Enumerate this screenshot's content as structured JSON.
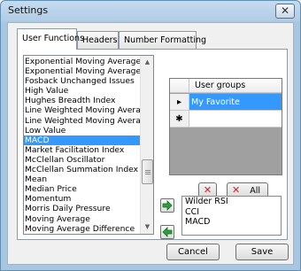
{
  "window": {
    "title": "Settings",
    "close_glyph": "✕"
  },
  "tabs": [
    {
      "label": "User Functions"
    },
    {
      "label": "Headers"
    },
    {
      "label": "Number Formatting"
    }
  ],
  "functions": {
    "items": [
      "Exponential Moving Average (",
      "Exponential Moving Average (",
      "Fosback Unchanged Issues",
      "High Value",
      "Hughes Breadth Index",
      "Line Weighted Moving Averag",
      "Line Weighted Moving Averag",
      "Low Value",
      "MACD",
      "Market Facilitation Index",
      "McClellan Oscillator",
      "McClellan Summation Index",
      "Mean",
      "Median Price",
      "Momentum",
      "Morris Daily Pressure",
      "Moving Average",
      "Moving Average Difference"
    ],
    "selected_index": 8
  },
  "user_groups": {
    "column_header": "User groups",
    "rows": [
      {
        "indicator": "▸",
        "value": "My Favorite"
      },
      {
        "indicator": "✱",
        "value": ""
      }
    ]
  },
  "group_buttons": {
    "delete_icon": "✕",
    "delete_all_label": "All"
  },
  "group_functions": {
    "items": [
      "Wilder RSI",
      "CCI",
      "MACD"
    ]
  },
  "actions": {
    "cancel_label": "Cancel",
    "save_label": "Save"
  },
  "colors": {
    "selection": "#3399ff",
    "add_arrow": "#2e9e3a",
    "delete": "#d42020"
  },
  "icons": {
    "add": "arrow-right-icon",
    "remove": "arrow-left-icon"
  }
}
